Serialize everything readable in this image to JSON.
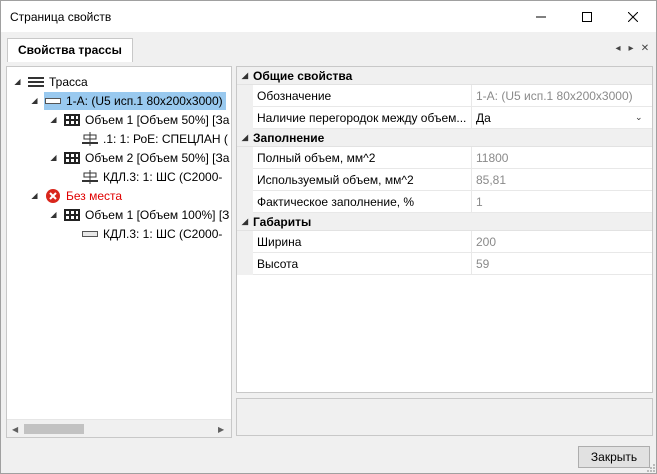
{
  "window": {
    "title": "Страница свойств"
  },
  "tab": {
    "label": "Свойства трассы"
  },
  "tree": {
    "root": {
      "label": "Трасса",
      "icon": "route-icon"
    },
    "items": [
      {
        "label": "1-А: (U5 исп.1 80x200x3000)",
        "icon": "channel-icon",
        "selected": true
      },
      {
        "label": "Объем 1 [Объем 50%] [За",
        "icon": "volume-grid-icon"
      },
      {
        "label": ".1: 1: РоЕ: СПЕЦЛАН  (",
        "icon": "cable-icon"
      },
      {
        "label": "Объем 2 [Объем 50%] [За",
        "icon": "volume-grid-icon"
      },
      {
        "label": "КДЛ.3: 1: ШС  (С2000-",
        "icon": "cable-icon"
      },
      {
        "label": "Без места",
        "icon": "error-icon",
        "color": "#e00000"
      },
      {
        "label": "Объем 1 [Объем 100%] [З",
        "icon": "volume-grid-icon"
      },
      {
        "label": "КДЛ.3: 1: ШС  (С2000-",
        "icon": "cable-icon"
      }
    ]
  },
  "properties": {
    "general": {
      "title": "Общие свойства",
      "rows": [
        {
          "name": "Обозначение",
          "value": "1-А: (U5 исп.1 80x200x3000)"
        },
        {
          "name": "Наличие перегородок между объем...",
          "value": "Да"
        }
      ]
    },
    "filling": {
      "title": "Заполнение",
      "rows": [
        {
          "name": "Полный объем, мм^2",
          "value": "11800"
        },
        {
          "name": "Используемый объем, мм^2",
          "value": "85,81"
        },
        {
          "name": "Фактическое заполнение, %",
          "value": "1"
        }
      ]
    },
    "dimensions": {
      "title": "Габариты",
      "rows": [
        {
          "name": "Ширина",
          "value": "200"
        },
        {
          "name": "Высота",
          "value": "59"
        }
      ]
    }
  },
  "footer": {
    "close_label": "Закрыть"
  }
}
